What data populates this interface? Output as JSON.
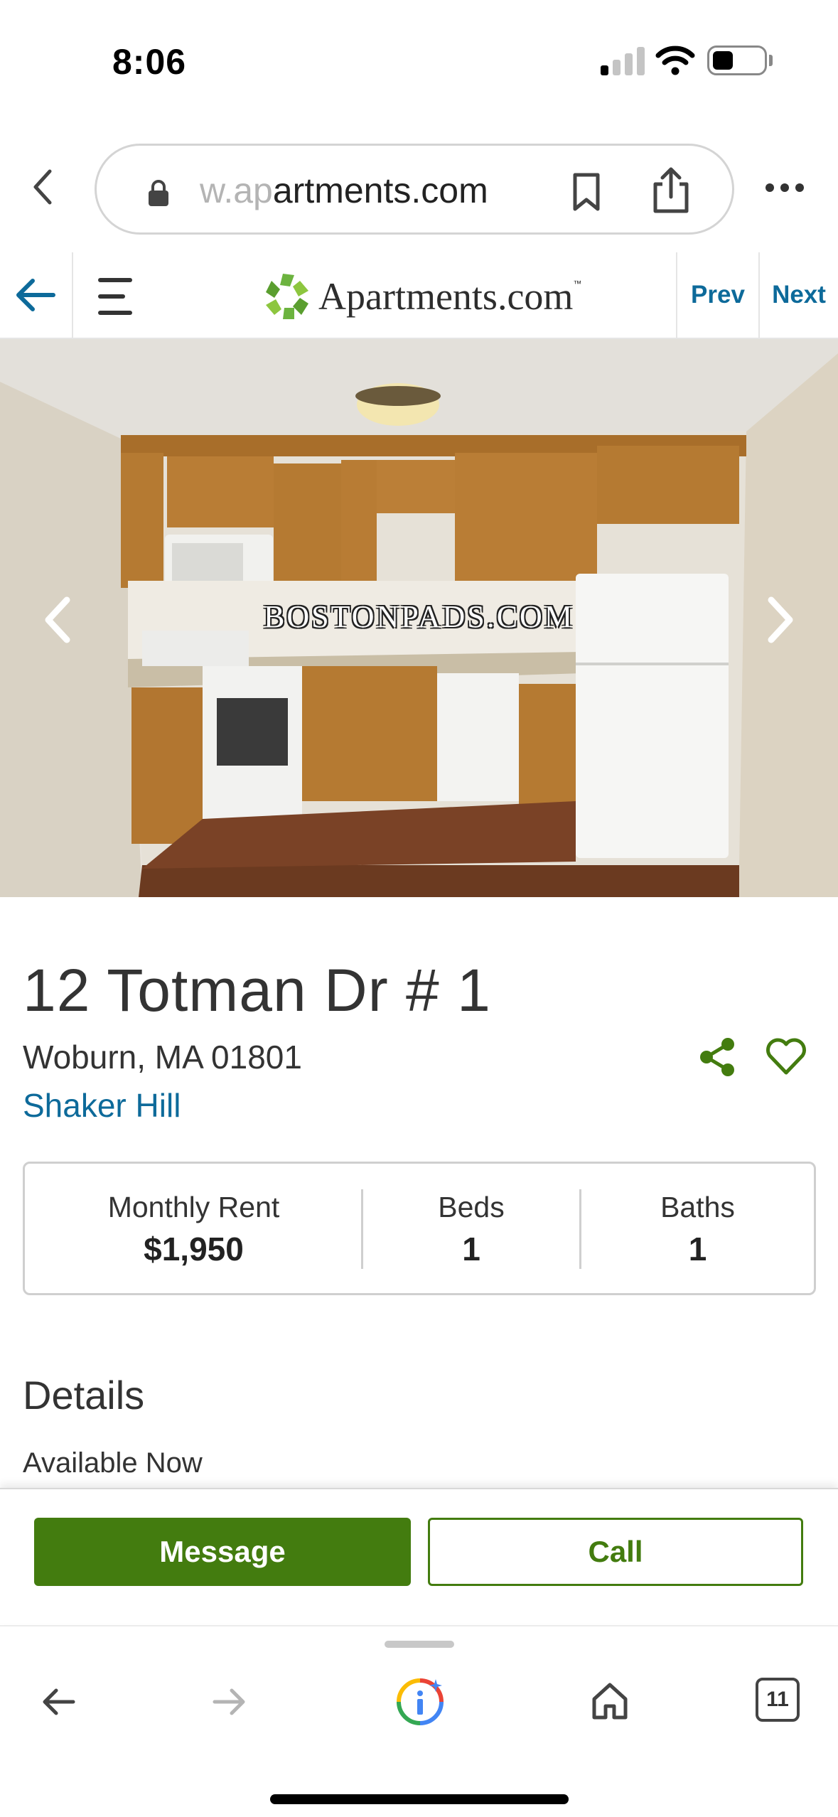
{
  "status_bar": {
    "time": "8:06",
    "icons": [
      "cellular-signal-icon",
      "wifi-icon",
      "battery-icon"
    ]
  },
  "browser": {
    "url_faded": "w.ap",
    "url_main": "artments.com",
    "icons": [
      "back-chevron-icon",
      "lock-icon",
      "bookmark-icon",
      "share-icon",
      "more-options-icon"
    ]
  },
  "site_header": {
    "logo_text": "Apartments.com",
    "logo_tm": "™",
    "prev_label": "Prev",
    "next_label": "Next",
    "accent_color": "#0d6a9a"
  },
  "photo": {
    "watermark": "BOSTONPADS.COM"
  },
  "listing": {
    "address": "12 Totman Dr # 1",
    "city": "Woburn, MA 01801",
    "neighborhood": "Shaker Hill",
    "stats": [
      {
        "label": "Monthly Rent",
        "value": "$1,950"
      },
      {
        "label": "Beds",
        "value": "1"
      },
      {
        "label": "Baths",
        "value": "1"
      }
    ],
    "details_title": "Details",
    "availability": "Available Now"
  },
  "actions": {
    "message_label": "Message",
    "call_label": "Call",
    "brand_color": "#437c0f"
  },
  "toolbar": {
    "tab_count": "11",
    "icons": [
      "back-arrow-icon",
      "forward-arrow-icon",
      "google-lens-icon",
      "home-icon",
      "tab-switcher-icon"
    ]
  }
}
